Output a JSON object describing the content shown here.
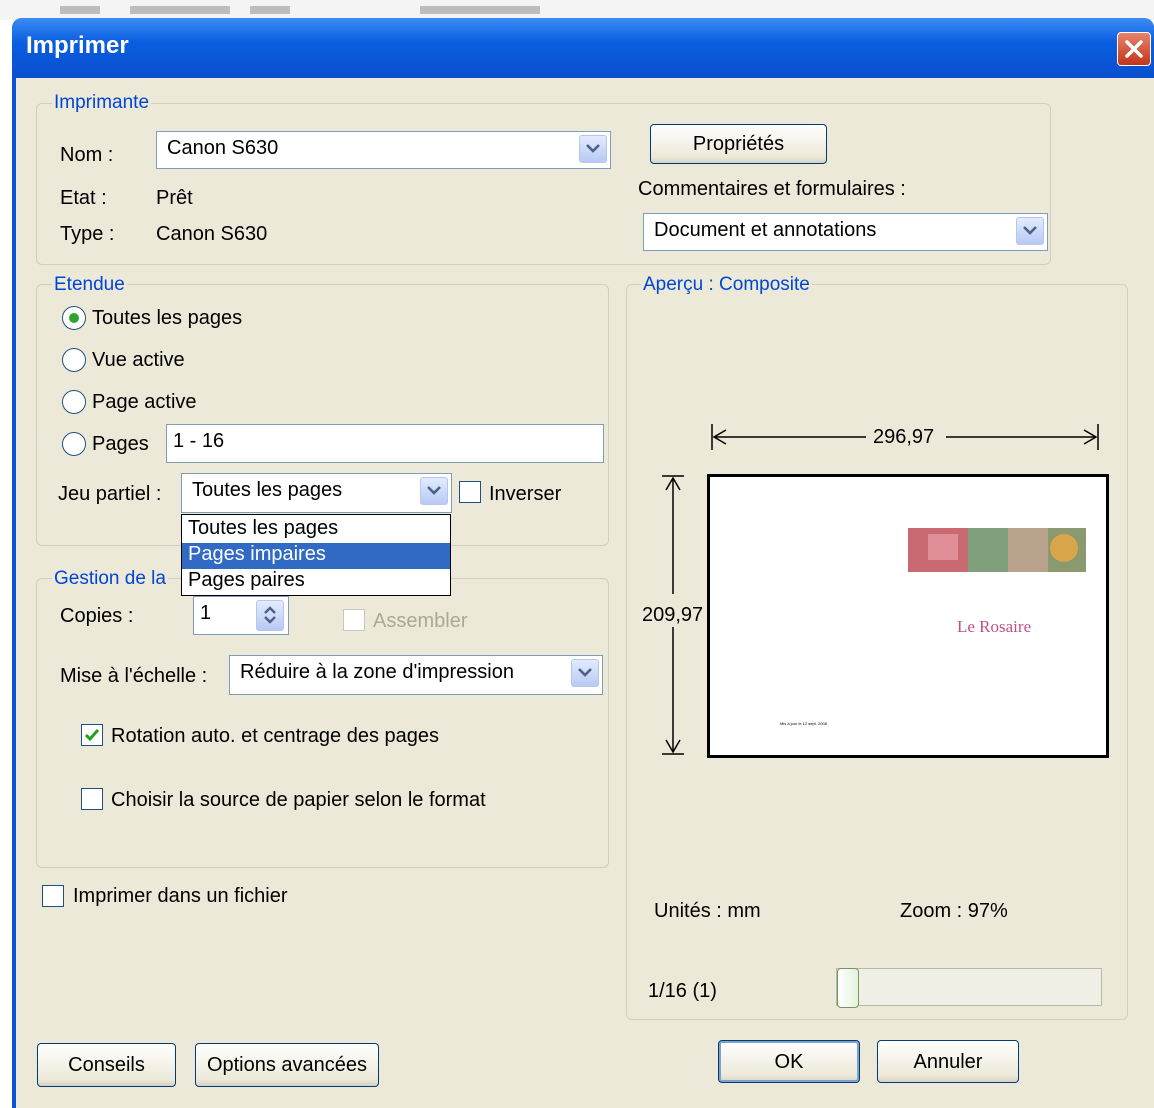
{
  "dialog": {
    "title": "Imprimer"
  },
  "printer": {
    "legend": "Imprimante",
    "name_label": "Nom :",
    "name_value": "Canon S630",
    "status_label": "Etat :",
    "status_value": "Prêt",
    "type_label": "Type :",
    "type_value": "Canon S630",
    "properties_button": "Propriétés",
    "comments_label": "Commentaires et formulaires :",
    "comments_value": "Document et annotations"
  },
  "range": {
    "legend": "Etendue",
    "options": [
      "Toutes les pages",
      "Vue active",
      "Page active",
      "Pages"
    ],
    "selected_index": 0,
    "pages_value": "1 - 16",
    "subset_label": "Jeu partiel :",
    "subset_value": "Toutes les pages",
    "subset_options": [
      "Toutes les pages",
      "Pages impaires",
      "Pages paires"
    ],
    "subset_highlighted": 1,
    "reverse_label": "Inverser"
  },
  "handling": {
    "legend": "Gestion de la",
    "copies_label": "Copies :",
    "copies_value": "1",
    "collate_label": "Assembler",
    "scaling_label": "Mise à l'échelle :",
    "scaling_value": "Réduire à la zone d'impression",
    "autorotate_label": "Rotation auto. et centrage des pages",
    "autorotate_checked": true,
    "paper_source_label": "Choisir la source de papier selon le format",
    "paper_source_checked": false
  },
  "print_to_file": {
    "label": "Imprimer dans un fichier",
    "checked": false
  },
  "preview": {
    "legend": "Aperçu : Composite",
    "width_value": "296,97",
    "height_value": "209,97",
    "page_title": "Le Rosaire",
    "page_footer": "Mis à jour le 12 sept. 2008",
    "units": "Unités : mm",
    "zoom": "Zoom : 97%",
    "page_indicator": "1/16 (1)",
    "slider_position": 0
  },
  "buttons": {
    "tips": "Conseils",
    "advanced": "Options avancées",
    "ok": "OK",
    "cancel": "Annuler"
  },
  "colors": {
    "titlebar": "#0a5ee0",
    "dialog_bg": "#ece9d8",
    "legend_text": "#0046d5",
    "selection": "#316ac5",
    "close_button": "#c2351b",
    "preview_title": "#c0508a"
  }
}
